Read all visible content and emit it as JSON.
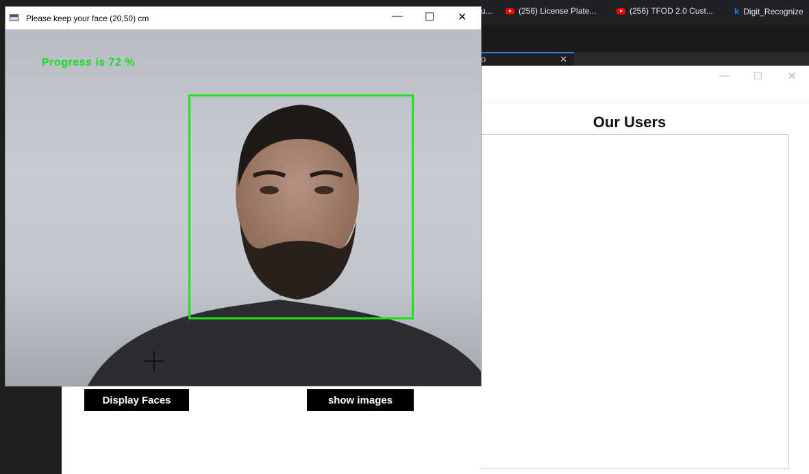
{
  "camera_window": {
    "title": "Please keep your face (20,50) cm",
    "progress_text": "Progress is  72 %",
    "progress_value": 72,
    "controls": {
      "minimize": "—",
      "maximize": "☐",
      "close": "✕"
    }
  },
  "browser": {
    "tabs": [
      {
        "label": "u...",
        "icon": "page-icon"
      },
      {
        "label": "(256) License Plate...",
        "icon": "youtube-icon"
      },
      {
        "label": "(256) TFOD 2.0 Cust...",
        "icon": "youtube-icon"
      },
      {
        "label": "Digit_Recognize",
        "icon": "kaggle-icon"
      }
    ]
  },
  "editor_tab": {
    "label": "o",
    "close": "✕"
  },
  "users_window": {
    "title": "Our Users",
    "controls": {
      "minimize": "—",
      "maximize": "☐",
      "close": "✕"
    }
  },
  "main_app": {
    "display_faces_label": "Display Faces",
    "show_images_label": "show images"
  },
  "colors": {
    "face_box": "#20e020",
    "progress_text": "#1ddb20"
  }
}
